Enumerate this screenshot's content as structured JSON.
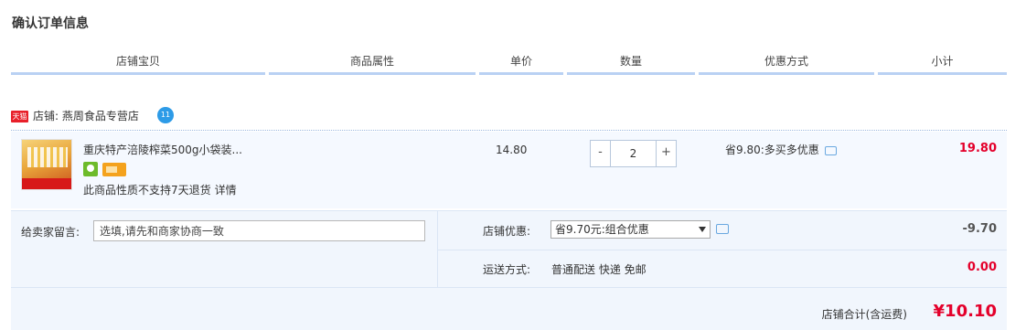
{
  "page_title": "确认订单信息",
  "columns": [
    "店铺宝贝",
    "商品属性",
    "单价",
    "数量",
    "优惠方式",
    "小计"
  ],
  "shop": {
    "badge": "天猫",
    "label": "店铺: 燕周食品专营店",
    "chat_icon_text": "11"
  },
  "item": {
    "name": "重庆特产涪陵榨菜500g小袋装...",
    "notice": "此商品性质不支持7天退货",
    "detail_link": "详情",
    "unit_price": "14.80",
    "quantity_minus": "-",
    "quantity_plus": "+",
    "quantity": "2",
    "promotion": "省9.80:多买多优惠",
    "subtotal": "19.80"
  },
  "order": {
    "message_label": "给卖家留言:",
    "message_placeholder": "选填,请先和商家协商一致",
    "shop_discount_label": "店铺优惠:",
    "shop_discount_selected": "省9.70元:组合优惠",
    "shop_discount_amount": "-9.70",
    "shipping_label": "运送方式:",
    "shipping_value": "普通配送 快递 免邮",
    "shipping_amount": "0.00"
  },
  "total": {
    "label": "店铺合计(含运费)",
    "amount": "¥10.10"
  },
  "colors": {
    "accent_red": "#e4002b",
    "header_line": "#b9d1f3",
    "row_bg": "#f5f9ff"
  }
}
